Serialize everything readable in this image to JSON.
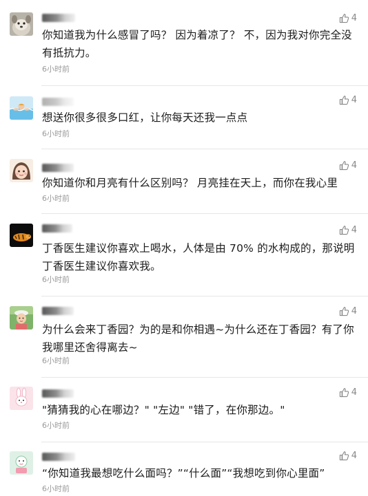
{
  "comments": [
    {
      "likes": "4",
      "text": "你知道我为什么感冒了吗？ 因为着凉了？ 不，因为我对你完全没有抵抗力。",
      "time": "6小时前",
      "avatar": "dog-avatar"
    },
    {
      "likes": "4",
      "text": "想送你很多很多口红，让你每天还我一点点",
      "time": "6小时前",
      "avatar": "swimmer-avatar"
    },
    {
      "likes": "4",
      "text": "你知道你和月亮有什么区别吗？ 月亮挂在天上，而你在我心里",
      "time": "6小时前",
      "avatar": "girl-avatar"
    },
    {
      "likes": "4",
      "text": "丁香医生建议你喜欢上喝水，人体是由 70% 的水构成的，那说明丁香医生建议你喜欢我。",
      "time": "6小时前",
      "avatar": "tiger-avatar"
    },
    {
      "likes": "4",
      "text": "为什么会来丁香园？为的是和你相遇~为什么还在丁香园？有了你我哪里还舍得离去~",
      "time": "6小时前",
      "avatar": "child-avatar"
    },
    {
      "likes": "4",
      "text": "\"猜猜我的心在哪边？\" \"左边\" \"错了，在你那边。\"",
      "time": "6小时前",
      "avatar": "rabbit-avatar"
    },
    {
      "likes": "4",
      "text": "“你知道我最想吃什么面吗？”“什么面”“我想吃到你心里面”",
      "time": "6小时前",
      "avatar": "cartoon-avatar"
    }
  ]
}
